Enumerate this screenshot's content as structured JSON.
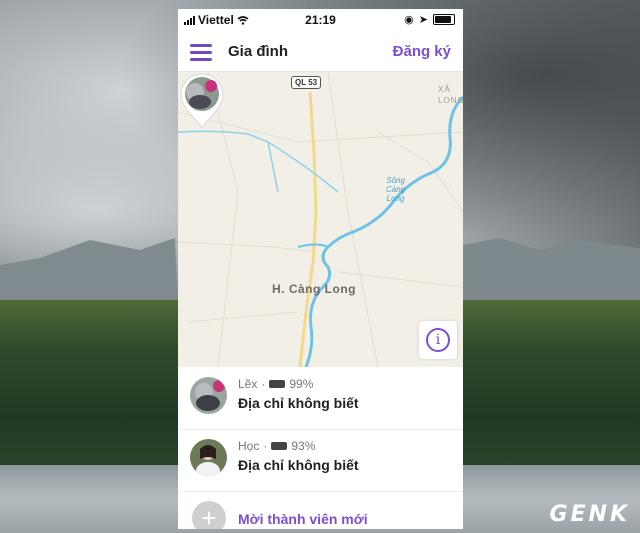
{
  "status_bar": {
    "carrier": "Viettel",
    "time": "21:19"
  },
  "navbar": {
    "title": "Gia đình",
    "action": "Đăng ký"
  },
  "map": {
    "road_badge": "QL 53",
    "place_label": "H. Càng Long",
    "river_label": "Sông\nCàng\nLong",
    "corner_label": "XÃ\nLONG"
  },
  "members": [
    {
      "name": "Lẽx",
      "battery": "99%",
      "address": "Địa chỉ không biết"
    },
    {
      "name": "Học",
      "battery": "93%",
      "address": "Địa chỉ không biết"
    }
  ],
  "invite_label": "Mời thành viên mới",
  "watermark": "GENK",
  "colors": {
    "accent": "#7a4fd1",
    "river": "#6cc3e6",
    "map_bg": "#f2efe7"
  }
}
